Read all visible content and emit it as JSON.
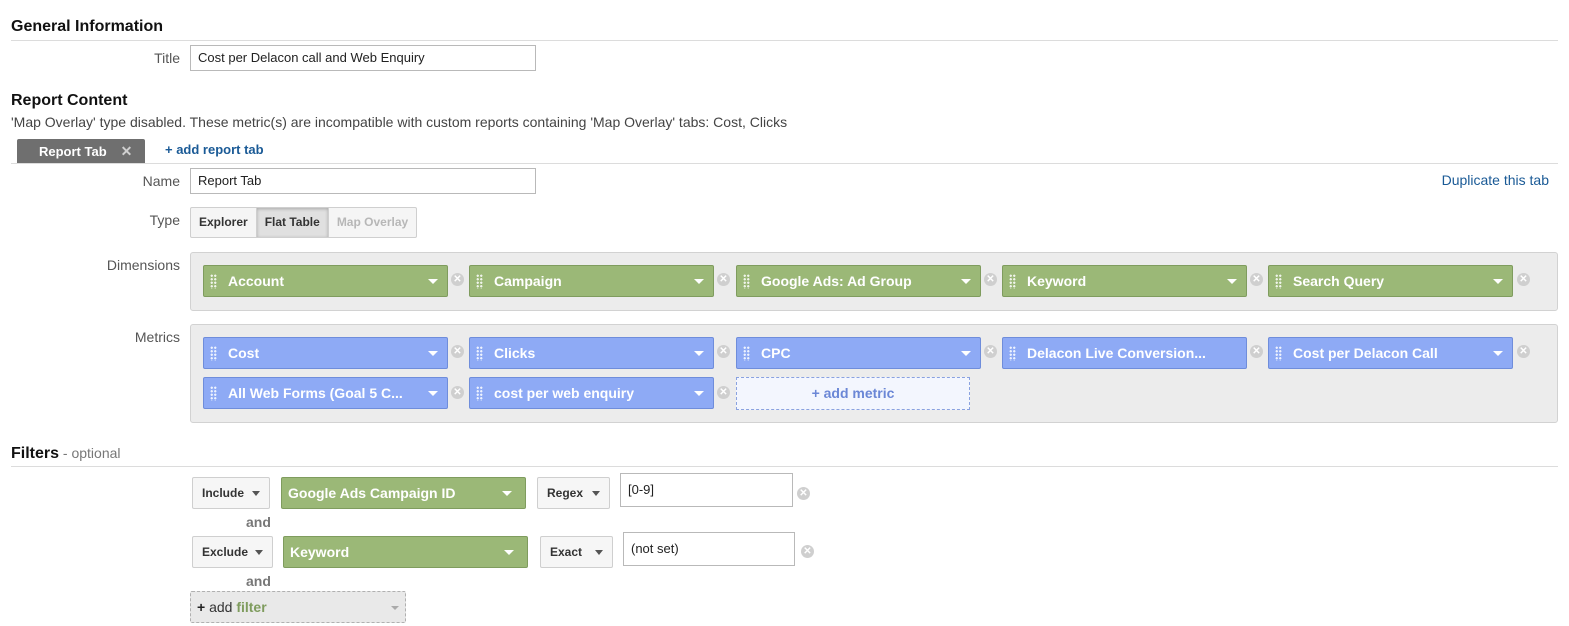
{
  "general": {
    "heading": "General Information",
    "title_label": "Title",
    "title_value": "Cost per Delacon call and Web Enquiry"
  },
  "report": {
    "heading": "Report Content",
    "notice": "'Map Overlay' type disabled. These metric(s) are incompatible with custom reports containing 'Map Overlay' tabs: Cost, Clicks",
    "active_tab": "Report Tab",
    "tab_close": "✕",
    "add_tab": "+ add report tab",
    "name_label": "Name",
    "name_value": "Report Tab",
    "duplicate": "Duplicate this tab",
    "type_label": "Type",
    "types": [
      "Explorer",
      "Flat Table",
      "Map Overlay"
    ],
    "type_selected": "Flat Table",
    "type_disabled": "Map Overlay",
    "dimensions_label": "Dimensions",
    "dimensions": [
      "Account",
      "Campaign",
      "Google Ads: Ad Group",
      "Keyword",
      "Search Query"
    ],
    "metrics_label": "Metrics",
    "metrics": [
      "Cost",
      "Clicks",
      "CPC",
      "Delacon Live Conversion...",
      "Cost per Delacon Call",
      "All Web Forms (Goal 5 C...",
      "cost per web enquiry"
    ],
    "add_metric": "+ add metric"
  },
  "filters": {
    "heading": "Filters",
    "optional": "- optional",
    "rows": [
      {
        "mode": "Include",
        "dimension": "Google Ads Campaign ID",
        "match": "Regex",
        "value": "[0-9]"
      },
      {
        "mode": "Exclude",
        "dimension": "Keyword",
        "match": "Exact",
        "value": "(not set)"
      }
    ],
    "and": "and",
    "add_filter_plus": "+",
    "add_filter_add": "add",
    "add_filter_word": "filter"
  },
  "icons": {
    "remove": "⊗",
    "drag": "drag-handle-icon",
    "caret": "caret-down-icon"
  },
  "colors": {
    "dimension_chip": "#9bb877",
    "metric_chip": "#8eaaf5",
    "link": "#1a5a96",
    "active_tab": "#6f6f6f"
  }
}
